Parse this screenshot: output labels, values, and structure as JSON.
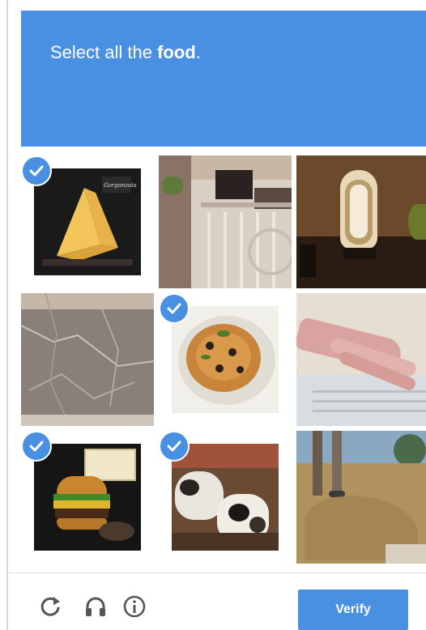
{
  "header": {
    "prompt_prefix": "Select all the ",
    "prompt_keyword": "food",
    "prompt_suffix": ".",
    "background_color": "#4a90e2"
  },
  "grid": {
    "tiles": [
      {
        "label": "cheese",
        "selected": true
      },
      {
        "label": "balcony",
        "selected": false
      },
      {
        "label": "lamp",
        "selected": false
      },
      {
        "label": "marble",
        "selected": false
      },
      {
        "label": "pasta",
        "selected": true
      },
      {
        "label": "hand",
        "selected": false
      },
      {
        "label": "burger",
        "selected": true
      },
      {
        "label": "cats",
        "selected": true
      },
      {
        "label": "ground",
        "selected": false
      }
    ],
    "check_color": "#4a90e2",
    "cheese_label_text": "Gorgonzola"
  },
  "footer": {
    "reload_icon": "reload-icon",
    "audio_icon": "headphones-icon",
    "info_icon": "info-icon",
    "verify_label": "Verify",
    "accent_color": "#4a90e2"
  }
}
